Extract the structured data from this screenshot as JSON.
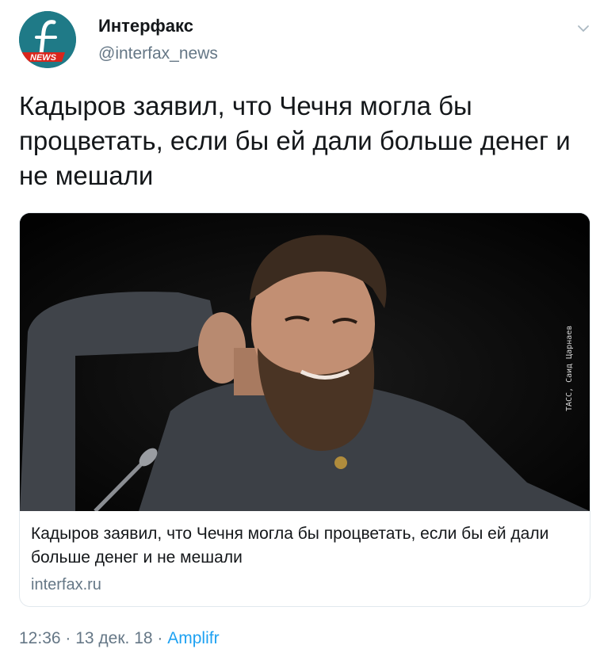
{
  "tweet": {
    "author_name": "Интерфакс",
    "author_handle": "@interfax_news",
    "avatar_badge": "NEWS",
    "text": "Кадыров заявил, что Чечня могла бы процветать, если бы ей дали больше денег и не мешали"
  },
  "card": {
    "title": "Кадыров заявил, что Чечня могла бы процветать, если бы ей дали больше денег и не мешали",
    "domain": "interfax.ru",
    "photo_credit": "ТАСС, Саид Царнаев"
  },
  "meta": {
    "time": "12:36",
    "sep1": " · ",
    "date": "13 дек. 18",
    "sep2": " · ",
    "source": "Amplifr"
  },
  "icons": {
    "menu": "chevron-down-icon",
    "avatar": "interfax-logo-icon"
  },
  "colors": {
    "avatar_bg": "#1f7a87",
    "badge_red": "#d9251c",
    "link_blue": "#1da1f2",
    "muted_gray": "#657786"
  }
}
